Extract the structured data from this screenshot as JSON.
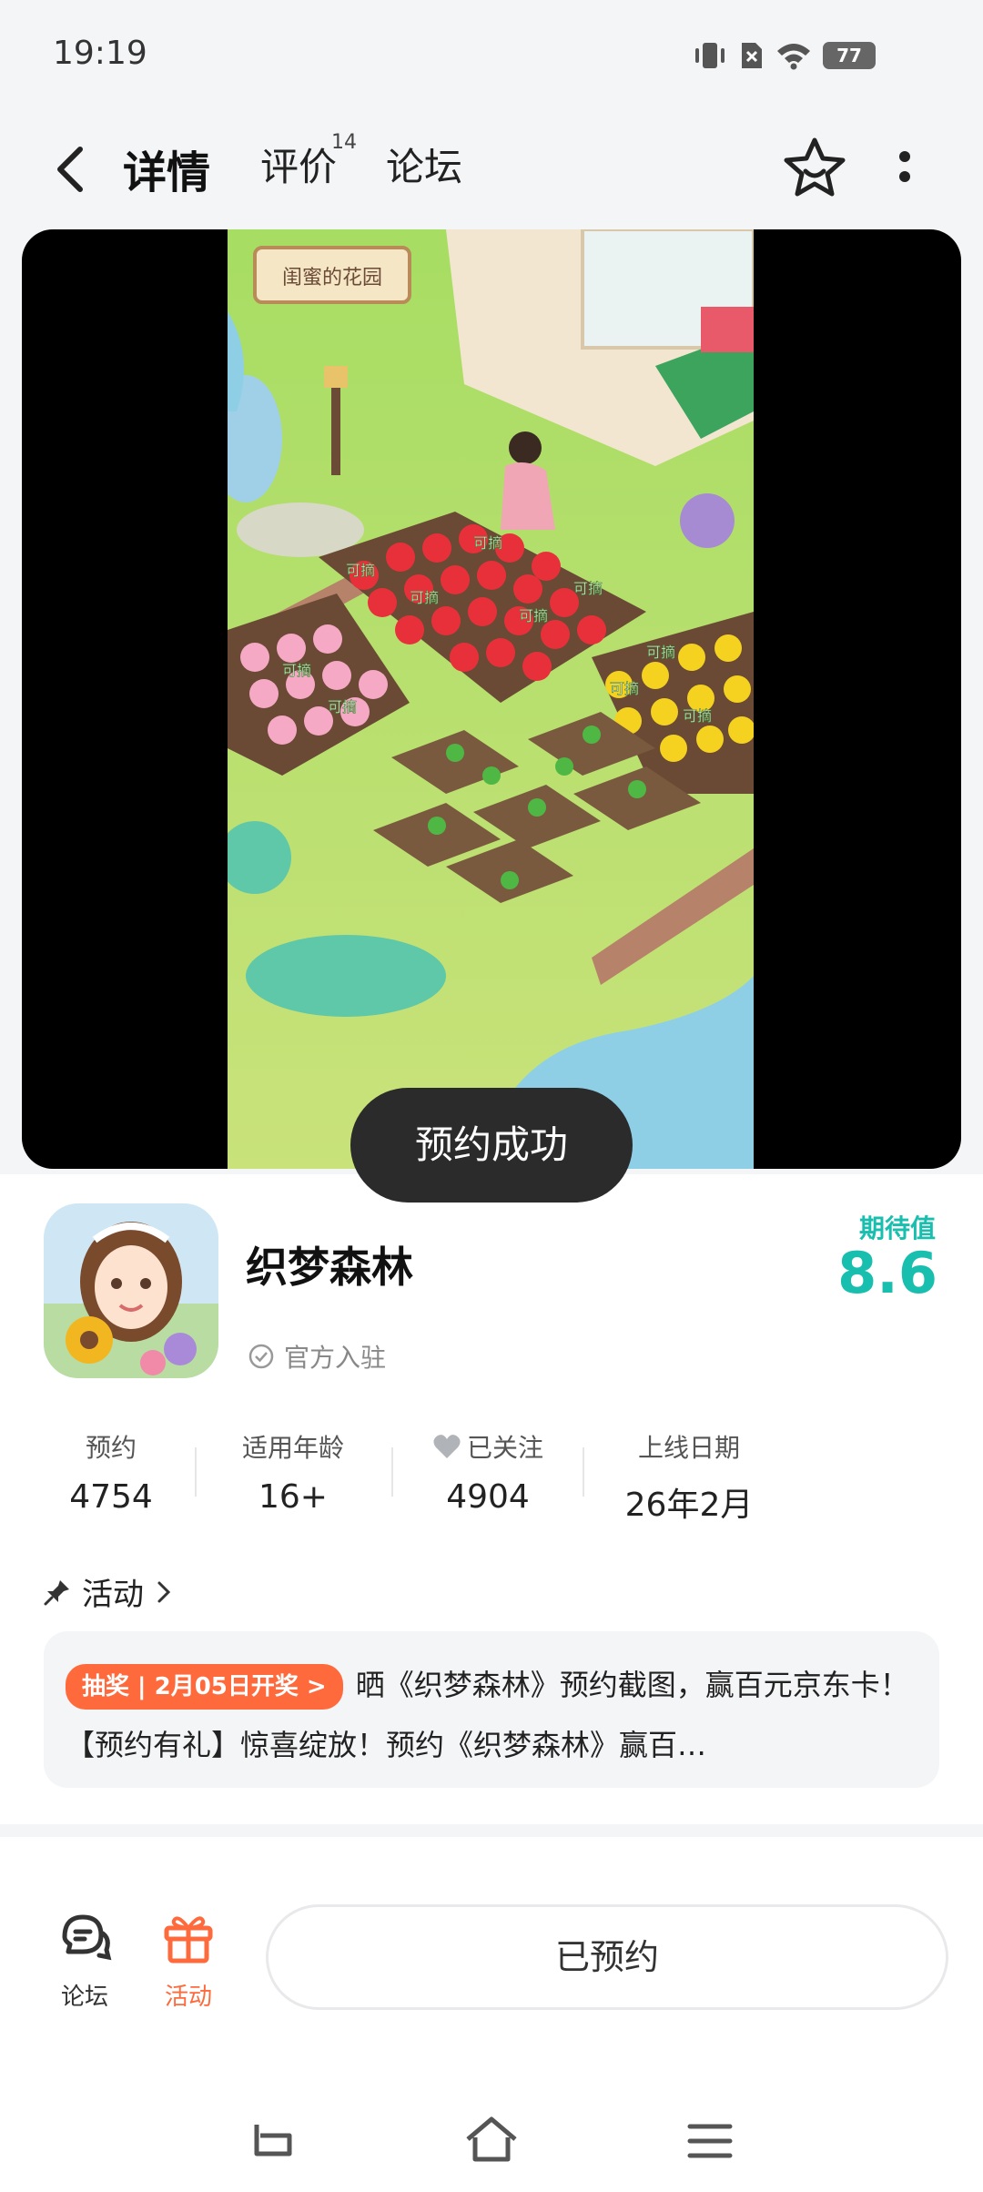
{
  "status_bar": {
    "time": "19:19",
    "battery": "77",
    "icons": [
      "vibrate-icon",
      "no-sim-icon",
      "wifi-icon",
      "battery-icon"
    ]
  },
  "header": {
    "tabs": [
      {
        "label": "详情",
        "active": true
      },
      {
        "label": "评价",
        "badge": "14"
      },
      {
        "label": "论坛"
      }
    ]
  },
  "media": {
    "signboard": "闺蜜的花园",
    "pick_label": "可摘"
  },
  "toast": "预约成功",
  "app": {
    "name": "织梦森林",
    "official": "官方入驻",
    "expectation_label": "期待值",
    "expectation_value": "8.6"
  },
  "stats": [
    {
      "label": "预约",
      "value": "4754"
    },
    {
      "label": "适用年龄",
      "value": "16+"
    },
    {
      "label": "已关注",
      "value": "4904"
    },
    {
      "label": "上线日期",
      "value": "26年2月"
    }
  ],
  "activity": {
    "title": "活动",
    "badge": "抽奖 | 2月05日开奖 >",
    "text": "晒《织梦森林》预约截图，赢百元京东卡！【预约有礼】惊喜绽放！预约《织梦森林》赢百…"
  },
  "bottom_bar": {
    "forum_label": "论坛",
    "activity_label": "活动",
    "reserve_label": "已预约"
  },
  "colors": {
    "accent": "#18bfae",
    "orange": "#ff6a3d",
    "background": "#f4f5f7"
  }
}
